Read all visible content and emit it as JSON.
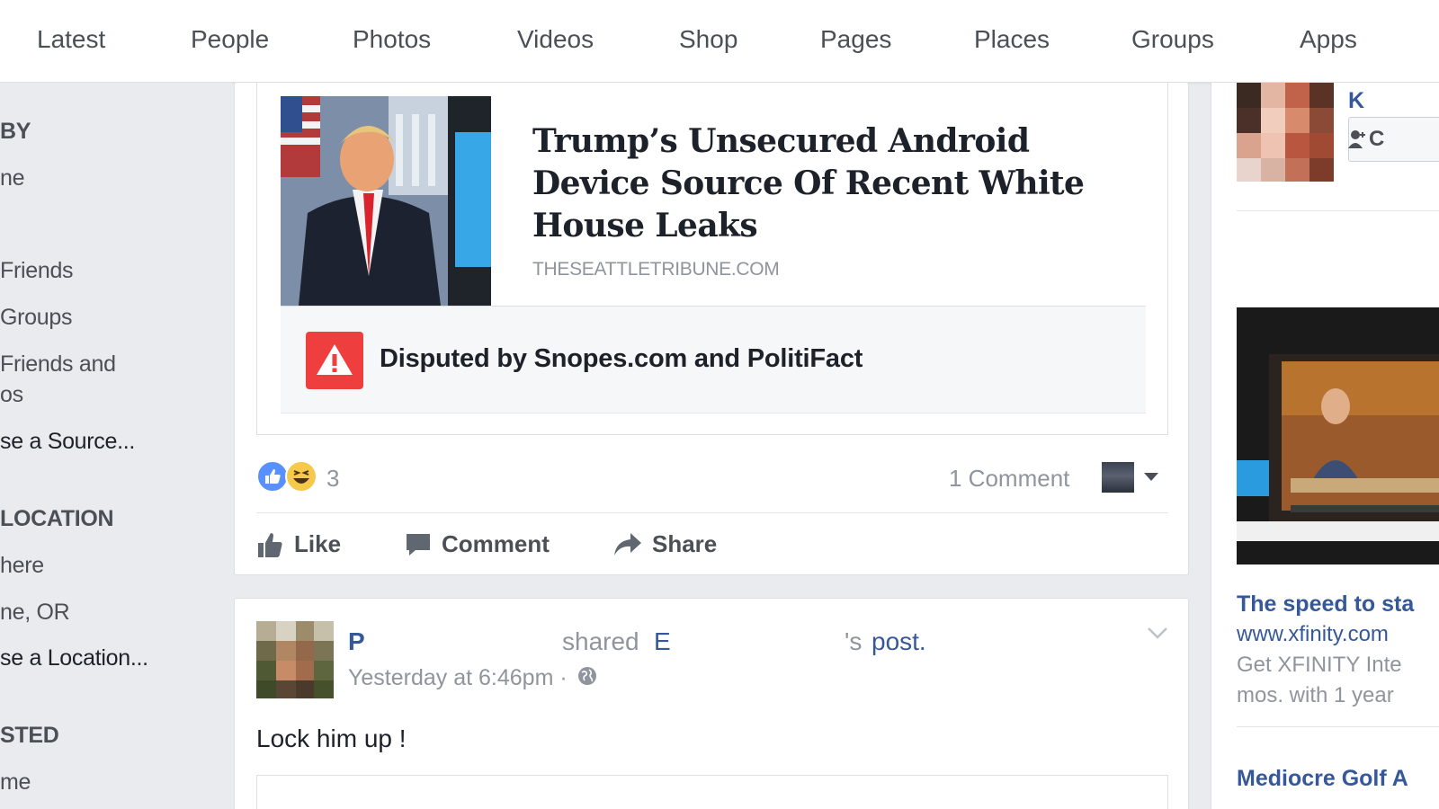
{
  "nav": {
    "tabs": [
      "Latest",
      "People",
      "Photos",
      "Videos",
      "Shop",
      "Pages",
      "Places",
      "Groups",
      "Apps"
    ]
  },
  "sidebar": {
    "items": [
      {
        "text": "BY",
        "kind": "head"
      },
      {
        "text": "ne",
        "kind": "item"
      },
      {
        "text": "Friends",
        "kind": "item"
      },
      {
        "text": "Groups",
        "kind": "item"
      },
      {
        "text": "Friends and",
        "kind": "item"
      },
      {
        "text": "os",
        "kind": "item"
      },
      {
        "text": "se a Source...",
        "kind": "link"
      },
      {
        "text": "LOCATION",
        "kind": "head"
      },
      {
        "text": "here",
        "kind": "item"
      },
      {
        "text": "ne, OR",
        "kind": "item"
      },
      {
        "text": "se a Location...",
        "kind": "link"
      },
      {
        "text": "STED",
        "kind": "head"
      },
      {
        "text": "me",
        "kind": "item"
      }
    ]
  },
  "post1": {
    "headline": "Trump’s Unsecured Android Device Source Of Recent White House Leaks",
    "domain": "THESEATTLETRIBUNE.COM",
    "dispute": "Disputed by Snopes.com and PolitiFact",
    "reaction_count": "3",
    "comment_count": "1 Comment",
    "actions": {
      "like": "Like",
      "comment": "Comment",
      "share": "Share"
    }
  },
  "post2": {
    "author": "P",
    "shared": "shared",
    "shared_name": "E",
    "post_suffix": "'s",
    "post_link": "post.",
    "time": "Yesterday at 6:46pm ·",
    "body": "Lock him up !"
  },
  "rightcol": {
    "name": "K",
    "button": "C",
    "ad_title": "The speed to sta",
    "ad_url": "www.xfinity.com",
    "ad_desc1": "Get XFINITY Inte",
    "ad_desc2": "mos. with 1 year",
    "ad2_title": "Mediocre Golf A"
  },
  "colors": {
    "link": "#365899",
    "warning": "#ee3e3e",
    "like_blue": "#5890ff",
    "haha_yellow": "#f7c94b"
  }
}
